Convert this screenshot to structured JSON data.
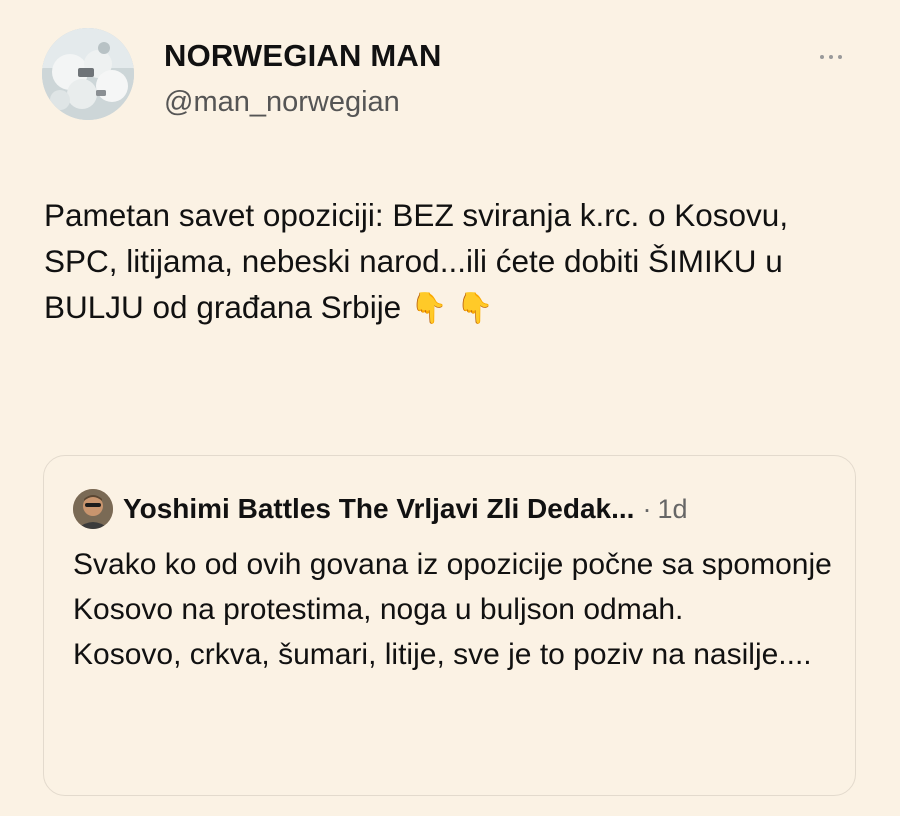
{
  "tweet": {
    "author": {
      "display_name": "NORWEGIAN MAN",
      "handle": "@man_norwegian",
      "avatar_icon": "snow-scene-avatar"
    },
    "more_icon": "more-options-icon",
    "text": "Pametan savet opoziciji: BEZ sviranja k.rc. o Kosovu, SPC, litijama, nebeski narod...ili ćete dobiti ŠIMIKU u BULJU od građana Srbije",
    "emojis": [
      "👇",
      "👇"
    ]
  },
  "quoted_tweet": {
    "author": {
      "display_name": "Yoshimi Battles The Vrljavi Zli Dedak...",
      "avatar_icon": "man-with-sunglasses-avatar"
    },
    "separator": "·",
    "time": "1d",
    "text": "Svako ko od ovih govana iz opozicije počne sa spomonje Kosovo na protestima, noga u buljson odmah.\nKosovo, crkva, šumari, litije, sve je to poziv na nasilje...."
  },
  "colors": {
    "background": "#fbf2e4",
    "text": "#111111",
    "secondary_text": "#555555",
    "card_border": "#e3dacd"
  }
}
